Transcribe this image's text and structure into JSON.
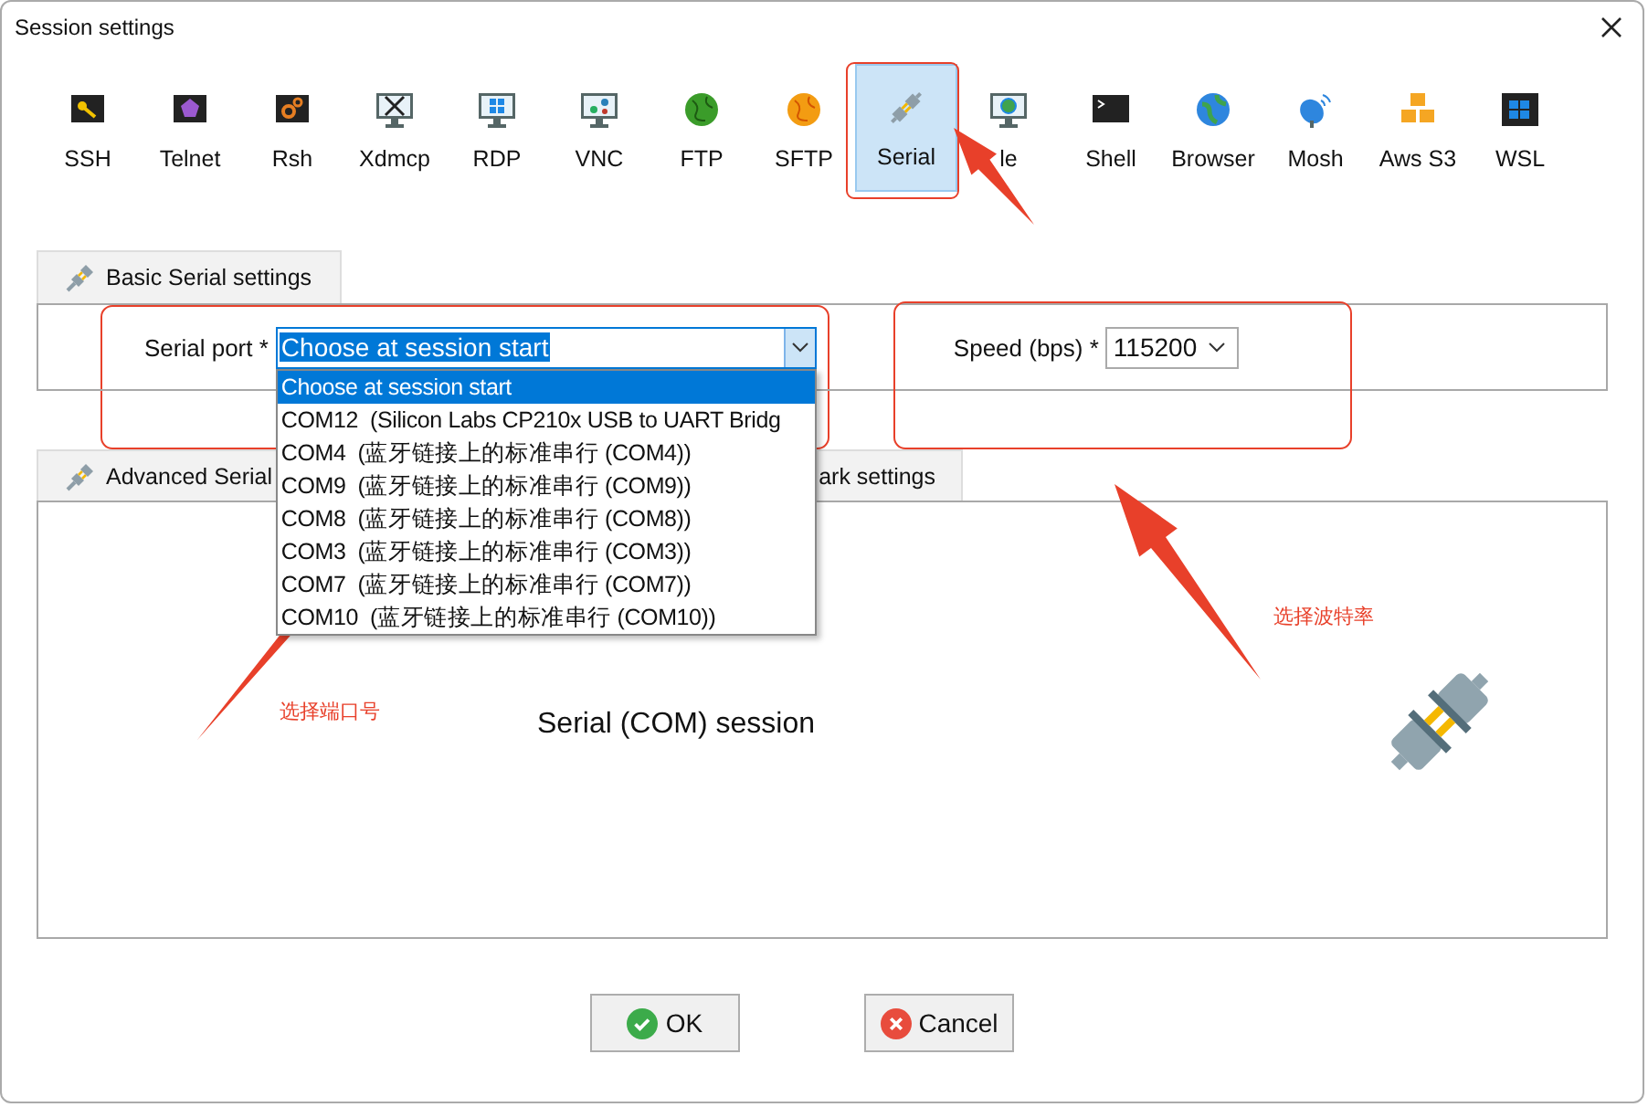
{
  "window": {
    "title": "Session settings"
  },
  "session_types": [
    {
      "label": "SSH",
      "kind": "key",
      "selected": false
    },
    {
      "label": "Telnet",
      "kind": "gem",
      "selected": false
    },
    {
      "label": "Rsh",
      "kind": "gears",
      "selected": false
    },
    {
      "label": "Xdmcp",
      "kind": "xmonitor",
      "selected": false
    },
    {
      "label": "RDP",
      "kind": "winmonitor",
      "selected": false
    },
    {
      "label": "VNC",
      "kind": "vncmonitor",
      "selected": false
    },
    {
      "label": "FTP",
      "kind": "greenglobe",
      "selected": false
    },
    {
      "label": "SFTP",
      "kind": "orangeglobe",
      "selected": false
    },
    {
      "label": "Serial",
      "kind": "plug",
      "selected": true
    },
    {
      "label": "le",
      "kind": "globemonitor",
      "selected": false
    },
    {
      "label": "Shell",
      "kind": "terminal",
      "selected": false
    },
    {
      "label": "Browser",
      "kind": "blueglobe",
      "selected": false
    },
    {
      "label": "Mosh",
      "kind": "dish",
      "selected": false
    },
    {
      "label": "Aws S3",
      "kind": "cubes",
      "selected": false
    },
    {
      "label": "WSL",
      "kind": "windows",
      "selected": false
    }
  ],
  "basic_tab": {
    "label": "Basic Serial settings"
  },
  "serial_port": {
    "label": "Serial port *",
    "value": "Choose at session start",
    "options": [
      {
        "label": "Choose at session start",
        "selected": true
      },
      {
        "label": "COM12  (Silicon Labs CP210x USB to UART Bridg",
        "selected": false
      },
      {
        "label": "COM4  (蓝牙链接上的标准串行 (COM4))",
        "selected": false
      },
      {
        "label": "COM9  (蓝牙链接上的标准串行 (COM9))",
        "selected": false
      },
      {
        "label": "COM8  (蓝牙链接上的标准串行 (COM8))",
        "selected": false
      },
      {
        "label": "COM3  (蓝牙链接上的标准串行 (COM3))",
        "selected": false
      },
      {
        "label": "COM7  (蓝牙链接上的标准串行 (COM7))",
        "selected": false
      },
      {
        "label": "COM10  (蓝牙链接上的标准串行 (COM10))",
        "selected": false
      }
    ]
  },
  "speed": {
    "label": "Speed (bps) *",
    "value": "115200"
  },
  "lower_tabs": [
    {
      "label": "Advanced Serial"
    },
    {
      "label": "ark settings"
    }
  ],
  "panel_title": "Serial (COM) session",
  "buttons": [
    {
      "label": "OK",
      "kind": "ok"
    },
    {
      "label": "Cancel",
      "kind": "cancel"
    }
  ],
  "annotations": [
    {
      "text": "选择端口号"
    },
    {
      "text": "选择波特率"
    }
  ]
}
